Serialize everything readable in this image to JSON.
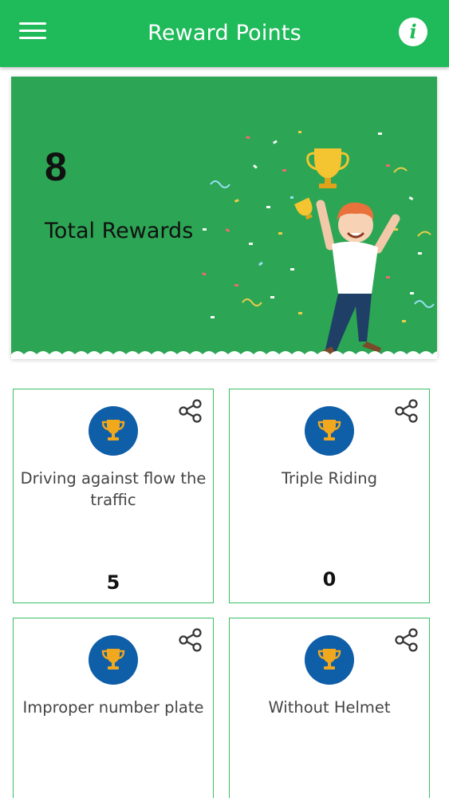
{
  "header": {
    "title": "Reward Points",
    "menu_icon": "hamburger-menu-icon",
    "info_icon": "info-icon",
    "info_glyph": "i",
    "color": "#1fba5a"
  },
  "summary": {
    "total_value": "8",
    "total_label": "Total Rewards",
    "background_color": "#2ca554"
  },
  "rewards": [
    {
      "title": "Driving against flow the traffic",
      "count": "5",
      "icon": "trophy-icon"
    },
    {
      "title": "Triple Riding",
      "count": "0",
      "icon": "trophy-icon"
    },
    {
      "title": "Improper number plate",
      "icon": "trophy-icon"
    },
    {
      "title": "Without Helmet",
      "icon": "trophy-icon"
    }
  ],
  "colors": {
    "accent_green": "#1fba5a",
    "badge_blue": "#0f5ea8",
    "trophy_gold": "#f2a81d",
    "tile_border": "#3bbf63"
  }
}
